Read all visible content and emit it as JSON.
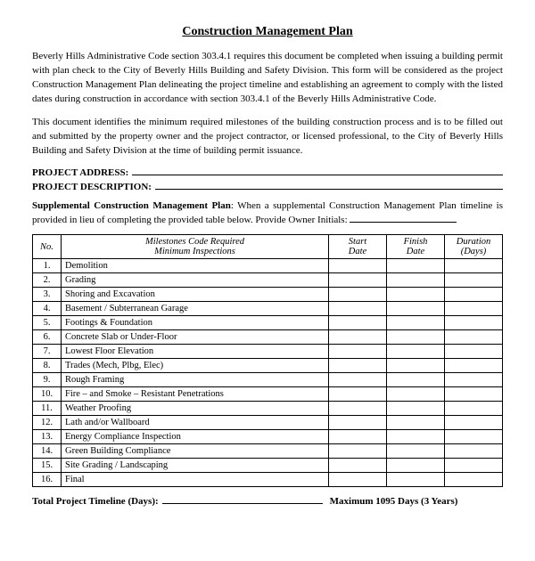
{
  "title": "Construction Management Plan",
  "intro1": "Beverly Hills Administrative Code section 303.4.1 requires this document be completed when issuing a building permit with plan check to the City of Beverly Hills Building and Safety Division.  This form will be considered as the project Construction Management Plan delineating the project timeline and establishing an agreement to comply with the listed dates during construction in accordance with section 303.4.1 of the Beverly Hills Administrative Code.",
  "intro2": "This document identifies the minimum required milestones of the building construction process and is to be filled out and submitted by the property owner and the project contractor, or licensed professional, to the City of Beverly Hills Building and Safety Division at the time of building permit issuance.",
  "field_project_address_label": "PROJECT ADDRESS:",
  "field_project_description_label": "PROJECT DESCRIPTION:",
  "supplemental_text": "Supplemental Construction Management Plan",
  "supplemental_body": ": When a supplemental Construction Management Plan timeline is provided in lieu of completing the provided table below. Provide Owner Initials:",
  "table_header_no": "No.",
  "table_header_milestones_line1": "Milestones Code Required",
  "table_header_milestones_line2": "Minimum Inspections",
  "table_header_start": "Start",
  "table_header_start2": "Date",
  "table_header_finish": "Finish",
  "table_header_finish2": "Date",
  "table_header_duration": "Duration",
  "table_header_duration2": "(Days)",
  "milestones": [
    {
      "no": "1.",
      "name": "Demolition"
    },
    {
      "no": "2.",
      "name": "Grading"
    },
    {
      "no": "3.",
      "name": "Shoring and Excavation"
    },
    {
      "no": "4.",
      "name": "Basement / Subterranean Garage"
    },
    {
      "no": "5.",
      "name": "Footings & Foundation"
    },
    {
      "no": "6.",
      "name": "Concrete Slab or Under-Floor"
    },
    {
      "no": "7.",
      "name": "Lowest Floor Elevation"
    },
    {
      "no": "8.",
      "name": "Trades (Mech, Plbg, Elec)"
    },
    {
      "no": "9.",
      "name": "Rough Framing"
    },
    {
      "no": "10.",
      "name": "Fire – and Smoke – Resistant Penetrations"
    },
    {
      "no": "11.",
      "name": "Weather Proofing"
    },
    {
      "no": "12.",
      "name": "Lath and/or Wallboard"
    },
    {
      "no": "13.",
      "name": "Energy Compliance Inspection"
    },
    {
      "no": "14.",
      "name": "Green Building Compliance"
    },
    {
      "no": "15.",
      "name": "Site Grading / Landscaping"
    },
    {
      "no": "16.",
      "name": "Final"
    }
  ],
  "total_label": "Total Project Timeline (Days):",
  "total_max": "Maximum 1095 Days (3 Years)"
}
